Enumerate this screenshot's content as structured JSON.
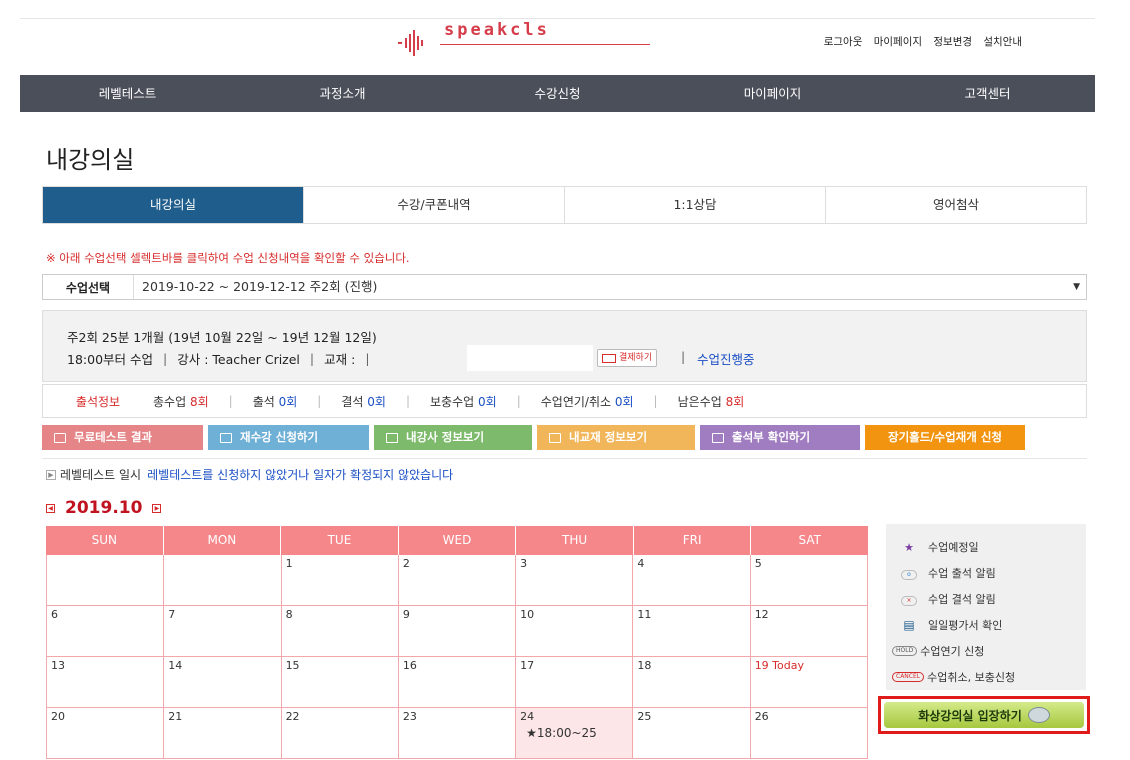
{
  "brand": {
    "name": "speakcls"
  },
  "util_links": [
    "로그아웃",
    "마이페이지",
    "정보변경",
    "설치안내"
  ],
  "gnb": [
    "레벨테스트",
    "과정소개",
    "수강신청",
    "마이페이지",
    "고객센터"
  ],
  "page_title": "내강의실",
  "tabs": [
    "내강의실",
    "수강/쿠폰내역",
    "1:1상담",
    "영어첨삭"
  ],
  "notice": "※ 아래 수업선택 셀렉트바를 클릭하여 수업 신청내역을 확인할 수 있습니다.",
  "class_select": {
    "label": "수업선택",
    "value": "2019-10-22 ~ 2019-12-12 주2회 (진행)"
  },
  "class_info": {
    "line1": "주2회 25분 1개월 (19년 10월 22일 ~ 19년 12월 12일)",
    "time": "18:00부터 수업",
    "teacher": "강사 : Teacher Crizel",
    "material": "교재 :",
    "pay_label": "결제하기",
    "status": "수업진행중"
  },
  "attendance": {
    "label": "출석정보",
    "total_label": "총수업",
    "total": "8회",
    "present_label": "출석",
    "present": "0회",
    "absent_label": "결석",
    "absent": "0회",
    "makeup_label": "보충수업",
    "makeup": "0회",
    "postpone_label": "수업연기/취소",
    "postpone": "0회",
    "remain_label": "남은수업",
    "remain": "8회"
  },
  "actions": [
    "무료테스트 결과",
    "재수강 신청하기",
    "내강사 정보보기",
    "내교재 정보보기",
    "출석부 확인하기",
    "장기홀드/수업재개 신청"
  ],
  "level_test": {
    "label": "레벨테스트 일시",
    "message": "레벨테스트를 신청하지 않았거나 일자가 확정되지 않았습니다"
  },
  "calendar": {
    "month": "2019.10",
    "weekdays": [
      "SUN",
      "MON",
      "TUE",
      "WED",
      "THU",
      "FRI",
      "SAT"
    ],
    "rows": [
      [
        "",
        "",
        "1",
        "2",
        "3",
        "4",
        "5"
      ],
      [
        "6",
        "7",
        "8",
        "9",
        "10",
        "11",
        "12"
      ],
      [
        "13",
        "14",
        "15",
        "16",
        "17",
        "18",
        "19 Today"
      ],
      [
        "20",
        "21",
        "22",
        "23",
        "24",
        "25",
        "26"
      ]
    ],
    "class_mark": "★18:00~25"
  },
  "legend": [
    "수업예정일",
    "수업 출석 알림",
    "수업 결석 알림",
    "일일평가서 확인",
    "수업연기 신청",
    "수업취소, 보충신청"
  ],
  "legend_tags": {
    "hold": "HOLD",
    "cancel": "CANCEL"
  },
  "enter_button": "화상강의실 입장하기"
}
